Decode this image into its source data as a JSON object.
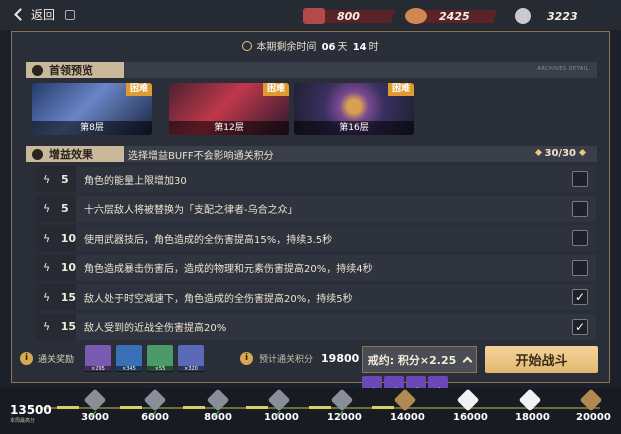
{
  "topbar": {
    "back_label": "返回",
    "resources": [
      {
        "icon": "ticket-icon",
        "value": "800"
      },
      {
        "icon": "crystal-icon",
        "value": "2425"
      },
      {
        "icon": "coin-icon",
        "value": "3223"
      }
    ]
  },
  "timer": {
    "prefix": "本期剩余时间",
    "days": "06",
    "days_unit": "天",
    "hours": "14",
    "hours_unit": "时"
  },
  "boss_section": {
    "title": "首领预览",
    "tag": "ARCHIVES DETAIL",
    "bosses": [
      {
        "difficulty": "困难",
        "floor": "第8层"
      },
      {
        "difficulty": "困难",
        "floor": "第12层"
      },
      {
        "difficulty": "困难",
        "floor": "第16层"
      }
    ]
  },
  "buff_section": {
    "title": "增益效果",
    "hint": "选择增益BUFF不会影响通关积分",
    "count": "30/30",
    "buffs": [
      {
        "level": "5",
        "text": "角色的能量上限增加30",
        "checked": false
      },
      {
        "level": "5",
        "text": "十六层敌人将被替换为「支配之律者-乌合之众」",
        "checked": false
      },
      {
        "level": "10",
        "text": "使用武器技后，角色造成的全伤害提高15%，持续3.5秒",
        "checked": false
      },
      {
        "level": "10",
        "text": "角色造成暴击伤害后，造成的物理和元素伤害提高20%，持续4秒",
        "checked": false
      },
      {
        "level": "15",
        "text": "敌人处于时空减速下，角色造成的全伤害提高20%，持续5秒",
        "checked": true
      },
      {
        "level": "15",
        "text": "敌人受到的近战全伤害提高20%",
        "checked": true
      }
    ]
  },
  "rewards": {
    "label": "通关奖励",
    "items": [
      {
        "icon": "reward-icon-1",
        "count": "×295"
      },
      {
        "icon": "reward-icon-2",
        "count": "×345"
      },
      {
        "icon": "reward-icon-3",
        "count": "×55"
      },
      {
        "icon": "reward-icon-4",
        "count": "×320"
      }
    ]
  },
  "predict": {
    "label": "预计通关积分",
    "value": "19800"
  },
  "pact": {
    "label": "戒约: 积分×2.25"
  },
  "start": {
    "label": "开始战斗"
  },
  "pills": [
    {
      "value": "+6"
    },
    {
      "value": "+5"
    },
    {
      "value": "+5"
    },
    {
      "value": "+5"
    }
  ],
  "track": {
    "best_value": "13500",
    "best_label": "本周最高分",
    "nodes": [
      {
        "value": "3000",
        "reached": true,
        "style": "grey"
      },
      {
        "value": "6000",
        "reached": true,
        "style": "grey"
      },
      {
        "value": "8000",
        "reached": true,
        "style": "grey"
      },
      {
        "value": "10000",
        "reached": true,
        "style": "grey"
      },
      {
        "value": "12000",
        "reached": true,
        "style": "grey"
      },
      {
        "value": "14000",
        "reached": false,
        "style": "gold"
      },
      {
        "value": "16000",
        "reached": false,
        "style": "white"
      },
      {
        "value": "18000",
        "reached": false,
        "style": "white"
      },
      {
        "value": "20000",
        "reached": false,
        "style": "gold"
      }
    ]
  }
}
